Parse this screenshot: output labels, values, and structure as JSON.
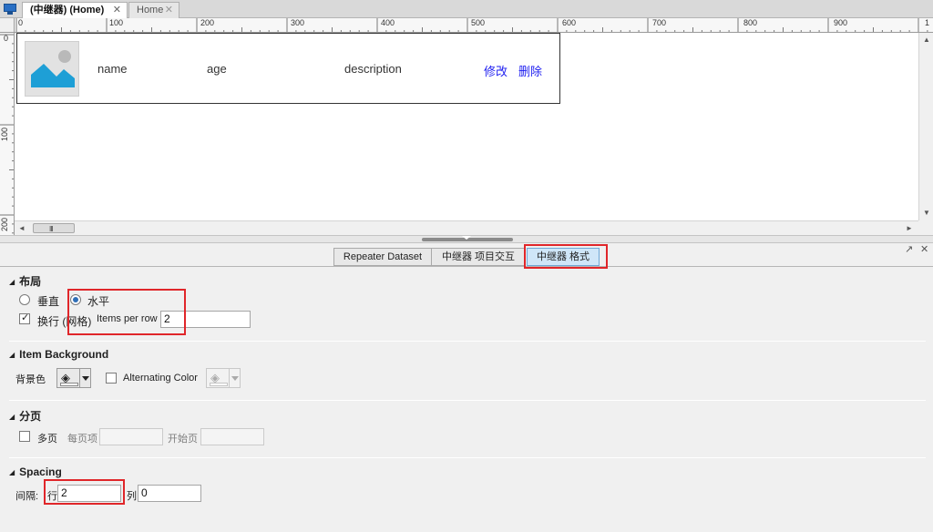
{
  "tabs": [
    {
      "label": "(中继器) (Home)",
      "close": "✕",
      "active": true
    },
    {
      "label": "Home",
      "close": "✕",
      "active": false
    }
  ],
  "ruler": {
    "top_labels": [
      "0",
      "100",
      "200",
      "300",
      "400",
      "500",
      "600",
      "700",
      "800",
      "900",
      "1"
    ],
    "left_labels": [
      "0",
      "100",
      "200"
    ]
  },
  "repeater_item": {
    "name": "name",
    "age": "age",
    "description": "description",
    "edit_label": "修改",
    "delete_label": "删除"
  },
  "scrollbar": {
    "up": "▲",
    "down": "▼",
    "left": "◄",
    "right": "►",
    "grip": "III"
  },
  "panel": {
    "controls": {
      "undock": "↗",
      "close": "✕"
    },
    "tabs": [
      "Repeater Dataset",
      "中继器 项目交互",
      "中继器 格式"
    ],
    "active_tab": "中继器 格式",
    "layout": {
      "title": "布局",
      "vertical_label": "垂直",
      "horizontal_label": "水平",
      "selected": "horizontal",
      "wrap_label": "换行 (网格)",
      "wrap_checked": true,
      "items_per_row_label": "Items per row",
      "items_per_row_value": "2"
    },
    "item_background": {
      "title": "Item Background",
      "bg_color_label": "背景色",
      "alternating_label": "Alternating Color",
      "alternating_checked": false
    },
    "pagination": {
      "title": "分页",
      "multi_page_label": "多页",
      "multi_page_checked": false,
      "per_page_label": "每页项",
      "per_page_value": "",
      "start_page_label": "开始页",
      "start_page_value": ""
    },
    "spacing": {
      "title": "Spacing",
      "gap_label": "间隔:",
      "row_label": "行",
      "row_value": "2",
      "col_label": "列",
      "col_value": "0"
    }
  },
  "colors": {
    "highlight": "#e0262a",
    "link": "#1f1ff0",
    "active_tab": "#cfe6f8",
    "image_accent": "#1e9fd6"
  }
}
